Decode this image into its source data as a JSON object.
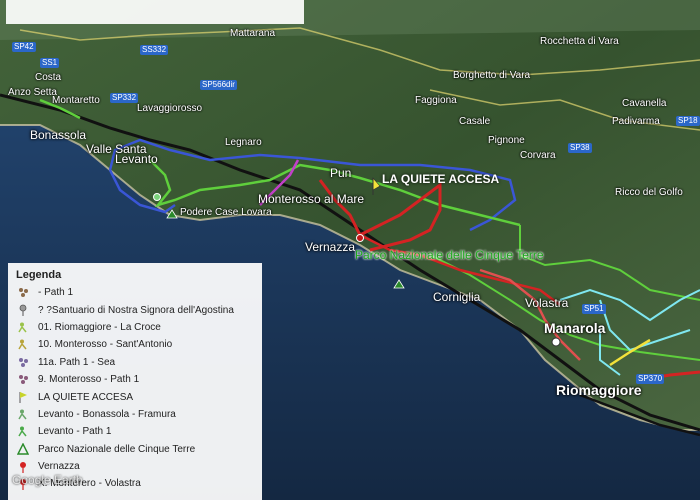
{
  "map": {
    "places": [
      {
        "id": "mattarana",
        "label": "Mattarana",
        "cls": "town-sm"
      },
      {
        "id": "rocchetta",
        "label": "Rocchetta di Vara",
        "cls": "town-sm"
      },
      {
        "id": "costa",
        "label": "Costa",
        "cls": "town-sm"
      },
      {
        "id": "anzo",
        "label": "Anzo Setta",
        "cls": "town-sm"
      },
      {
        "id": "montaretto",
        "label": "Montaretto",
        "cls": "town-sm"
      },
      {
        "id": "lavaggiorosso",
        "label": "Lavaggiorosso",
        "cls": "town-sm"
      },
      {
        "id": "borghetto",
        "label": "Borghetto di Vara",
        "cls": "town-sm"
      },
      {
        "id": "faggiona",
        "label": "Faggiona",
        "cls": "town-sm"
      },
      {
        "id": "bonassola",
        "label": "Bonassola",
        "cls": "town-md"
      },
      {
        "id": "legnaro",
        "label": "Legnaro",
        "cls": "town-sm"
      },
      {
        "id": "casale",
        "label": "Casale",
        "cls": "town-sm"
      },
      {
        "id": "cavanella",
        "label": "Cavanella",
        "cls": "town-sm"
      },
      {
        "id": "padivarma",
        "label": "Padivarma",
        "cls": "town-sm"
      },
      {
        "id": "vallesanta",
        "label": "Valle Santa",
        "cls": "town-md"
      },
      {
        "id": "levanto",
        "label": "Levanto",
        "cls": "town-md"
      },
      {
        "id": "pignone",
        "label": "Pignone",
        "cls": "town-sm"
      },
      {
        "id": "corvara",
        "label": "Corvara",
        "cls": "town-sm"
      },
      {
        "id": "pun",
        "label": "Pun",
        "cls": "town-md"
      },
      {
        "id": "ricco",
        "label": "Ricco del Golfo",
        "cls": "town-sm"
      },
      {
        "id": "monterosso",
        "label": "Monterosso al Mare",
        "cls": "town-md"
      },
      {
        "id": "podere",
        "label": "Podere Case Lovara",
        "cls": "town-sm"
      },
      {
        "id": "vernazza",
        "label": "Vernazza",
        "cls": "town-md"
      },
      {
        "id": "corniglia",
        "label": "Corniglia",
        "cls": "town-md"
      },
      {
        "id": "volastra",
        "label": "Volastra",
        "cls": "town-md"
      },
      {
        "id": "manarola",
        "label": "Manarola",
        "cls": "town-lg"
      },
      {
        "id": "riomaggiore",
        "label": "Riomaggiore",
        "cls": "town-lg"
      },
      {
        "id": "quiete",
        "label": "LA QUIETE ACCESA",
        "cls": "poi"
      },
      {
        "id": "parco",
        "label": "Parco Nazionale delle Cinque Terre",
        "cls": "park"
      }
    ],
    "roads": [
      {
        "id": "r1",
        "label": "SS332"
      },
      {
        "id": "r2",
        "label": "SS1"
      },
      {
        "id": "r3",
        "label": "SP332"
      },
      {
        "id": "r4",
        "label": "SP566dir"
      },
      {
        "id": "r5",
        "label": "SP38"
      },
      {
        "id": "r6",
        "label": "SP18"
      },
      {
        "id": "r7",
        "label": "SP370"
      },
      {
        "id": "r8",
        "label": "SP51"
      },
      {
        "id": "r9",
        "label": "SP42"
      }
    ],
    "colors": {
      "sea": "#1f3f68",
      "land": "#3c5a34",
      "trail_red": "#d42323",
      "trail_green": "#5fcf3c",
      "trail_blue": "#3a56d6",
      "trail_cyan": "#7fe7f0",
      "trail_yellow": "#f2e13a",
      "trail_magenta": "#c23fc9"
    }
  },
  "legend": {
    "title": "Legenda",
    "items": [
      {
        "label": "- Path 1",
        "icon": "people-icon"
      },
      {
        "label": "? ?Santuario di Nostra Signora dell'Agostina",
        "icon": "pin-icon"
      },
      {
        "label": "01. Riomaggiore - La Croce",
        "icon": "hiker-icon"
      },
      {
        "label": "10. Monterosso - Sant'Antonio",
        "icon": "hiker-icon"
      },
      {
        "label": "11a. Path 1 - Sea",
        "icon": "people-icon"
      },
      {
        "label": "9. Monterosso - Path 1",
        "icon": "people-icon"
      },
      {
        "label": "LA QUIETE ACCESA",
        "icon": "flag-icon"
      },
      {
        "label": "Levanto - Bonassola - Framura",
        "icon": "hiker-icon"
      },
      {
        "label": "Levanto - Path 1",
        "icon": "hiker-icon"
      },
      {
        "label": "Parco Nazionale delle Cinque Terre",
        "icon": "park-icon"
      },
      {
        "label": "Vernazza",
        "icon": "red-pin-icon"
      },
      {
        "label": "X. Monterero - Volastra",
        "icon": "red-pin-icon"
      }
    ]
  },
  "watermark": "Google Earth"
}
